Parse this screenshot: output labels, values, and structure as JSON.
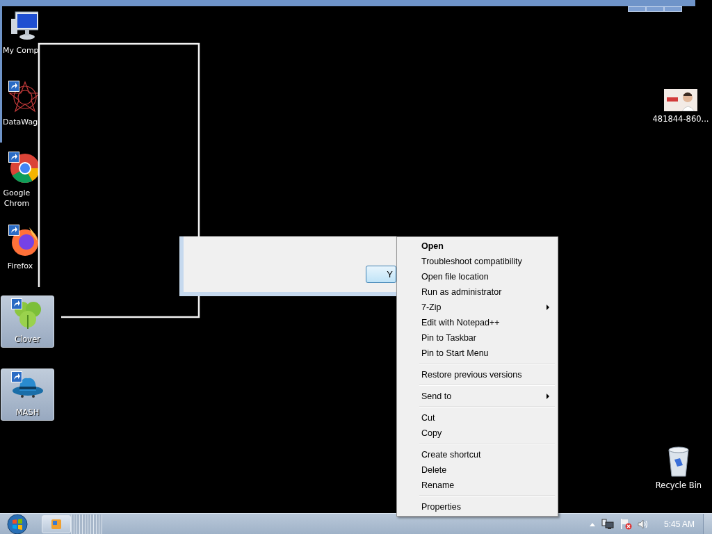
{
  "desktop_icons": [
    {
      "label": "My Comp",
      "kind": "computer",
      "shortcut": false,
      "selected": false
    },
    {
      "label": "DataWag",
      "kind": "star",
      "shortcut": true,
      "selected": false
    },
    {
      "label": "Google Chrom",
      "kind": "chrome",
      "shortcut": true,
      "selected": false
    },
    {
      "label": "Firefox",
      "kind": "firefox",
      "shortcut": true,
      "selected": false
    },
    {
      "label": "Clover",
      "kind": "clover",
      "shortcut": true,
      "selected": true
    },
    {
      "label": "MASH",
      "kind": "hat",
      "shortcut": true,
      "selected": true
    },
    {
      "label": "481844-860...",
      "kind": "picture",
      "shortcut": false,
      "selected": false
    },
    {
      "label": "Recycle Bin",
      "kind": "bin",
      "shortcut": false,
      "selected": false
    }
  ],
  "dialog": {
    "button": "Y"
  },
  "context_menu": [
    {
      "kind": "item",
      "label": "Open",
      "default": true
    },
    {
      "kind": "item",
      "label": "Troubleshoot compatibility",
      "default": false
    },
    {
      "kind": "item",
      "label": "Open file location",
      "default": false
    },
    {
      "kind": "item",
      "label": "Run as administrator",
      "default": false
    },
    {
      "kind": "submenu",
      "label": "7-Zip",
      "default": false
    },
    {
      "kind": "item",
      "label": "Edit with Notepad++",
      "default": false
    },
    {
      "kind": "item",
      "label": "Pin to Taskbar",
      "default": false
    },
    {
      "kind": "item",
      "label": "Pin to Start Menu",
      "default": false
    },
    {
      "kind": "separator"
    },
    {
      "kind": "item",
      "label": "Restore previous versions",
      "default": false
    },
    {
      "kind": "separator"
    },
    {
      "kind": "submenu",
      "label": "Send to",
      "default": false
    },
    {
      "kind": "separator"
    },
    {
      "kind": "item",
      "label": "Cut",
      "default": false
    },
    {
      "kind": "item",
      "label": "Copy",
      "default": false
    },
    {
      "kind": "separator"
    },
    {
      "kind": "item",
      "label": "Create shortcut",
      "default": false
    },
    {
      "kind": "item",
      "label": "Delete",
      "default": false
    },
    {
      "kind": "item",
      "label": "Rename",
      "default": false
    },
    {
      "kind": "separator"
    },
    {
      "kind": "item",
      "label": "Properties",
      "default": false
    }
  ],
  "taskbar": {
    "clock": "5:45 AM"
  }
}
